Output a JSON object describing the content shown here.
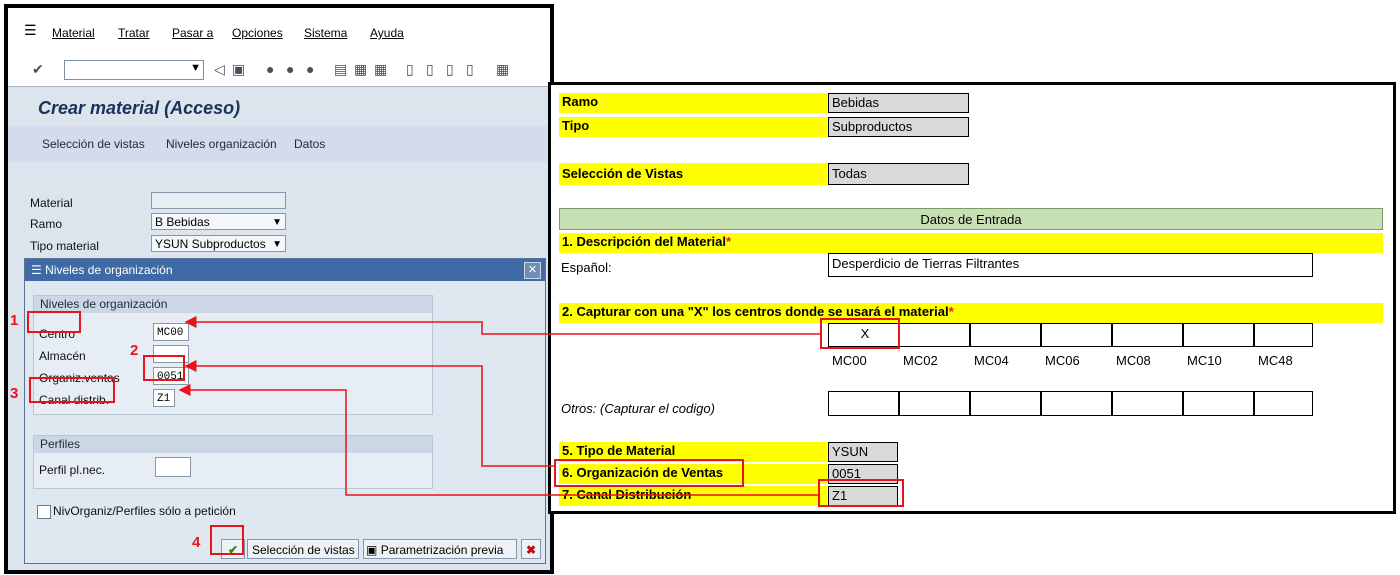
{
  "sap": {
    "menu": [
      "Material",
      "Tratar",
      "Pasar a",
      "Opciones",
      "Sistema",
      "Ayuda"
    ],
    "title": "Crear material (Acceso)",
    "app_toolbar": [
      "Selección de vistas",
      "Niveles organización",
      "Datos"
    ],
    "fields": {
      "material_label": "Material",
      "material_value": "",
      "ramo_label": "Ramo",
      "ramo_value": "B Bebidas",
      "tipo_label": "Tipo material",
      "tipo_value": "YSUN Subproductos"
    },
    "dialog": {
      "title": "Niveles de organización",
      "group_org": "Niveles de organización",
      "centro_label": "Centro",
      "centro_value": "MC00",
      "almacen_label": "Almacén",
      "almacen_value": "",
      "organiz_label": "Organiz.ventas",
      "organiz_value": "0051",
      "canal_label": "Canal distrib.",
      "canal_value": "Z1",
      "group_perfiles": "Perfiles",
      "perfil_label": "Perfil pl.nec.",
      "perfil_value": "",
      "checkbox_label": "NivOrganiz/Perfiles sólo a petición",
      "btn_seleccion": "Selección de vistas",
      "btn_param": "Parametrización previa"
    },
    "markers": [
      "1",
      "2",
      "3",
      "4"
    ]
  },
  "sheet": {
    "ramo_label": "Ramo",
    "ramo_value": "Bebidas",
    "tipo_label": "Tipo",
    "tipo_value": "Subproductos",
    "sel_label": "Selección de Vistas",
    "sel_value": "Todas",
    "datos_header": "Datos de Entrada",
    "desc_label": "1. Descripción del Material",
    "asterisk": "*",
    "espanol_label": "Español:",
    "espanol_value": "Desperdicio de Tierras Filtrantes",
    "centros_label": "2. Capturar con una \"X\" los centros donde se usará el material",
    "centro_x": "X",
    "centro_codes": [
      "MC00",
      "MC02",
      "MC04",
      "MC06",
      "MC08",
      "MC10",
      "MC48"
    ],
    "otros_label": "Otros: (Capturar el codigo)",
    "tipo_mat_label": "5. Tipo de Material",
    "tipo_mat_value": "YSUN",
    "org_label": "6. Organización de Ventas",
    "org_value": "0051",
    "canal_label": "7. Canal Distribución",
    "canal_value": "Z1"
  },
  "colors": {
    "highlight_yellow": "#ffff00",
    "header_green": "#c6e0b4",
    "marker_red": "#e8131b",
    "sap_dialog_title": "#3f6aa5"
  }
}
